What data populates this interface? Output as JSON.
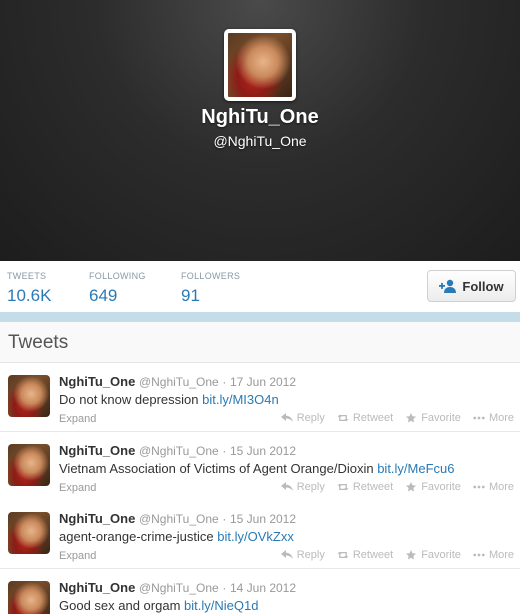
{
  "profile": {
    "name": "NghiTu_One",
    "handle": "@NghiTu_One"
  },
  "stats": {
    "tweets": {
      "label": "TWEETS",
      "value": "10.6K"
    },
    "following": {
      "label": "FOLLOWING",
      "value": "649"
    },
    "followers": {
      "label": "FOLLOWERS",
      "value": "91"
    }
  },
  "follow_button": {
    "label": "Follow"
  },
  "tweets_section": {
    "title": "Tweets"
  },
  "actions": {
    "reply": "Reply",
    "retweet": "Retweet",
    "favorite": "Favorite",
    "more": "More",
    "expand": "Expand"
  },
  "tweets": [
    {
      "author": "NghiTu_One",
      "handle": "@NghiTu_One",
      "date": "17 Jun 2012",
      "text": "Do not know depression",
      "link": "bit.ly/MI3O4n"
    },
    {
      "author": "NghiTu_One",
      "handle": "@NghiTu_One",
      "date": "15 Jun 2012",
      "text": "Vietnam Association of Victims of Agent Orange/Dioxin",
      "link": "bit.ly/MeFcu6"
    },
    {
      "author": "NghiTu_One",
      "handle": "@NghiTu_One",
      "date": "15 Jun 2012",
      "text": "agent-orange-crime-justice",
      "link": "bit.ly/OVkZxx"
    },
    {
      "author": "NghiTu_One",
      "handle": "@NghiTu_One",
      "date": "14 Jun 2012",
      "text": "Good sex and orgam",
      "link": "bit.ly/NieQ1d"
    }
  ],
  "colors": {
    "link": "#2a7ab5",
    "header_bg": "#2c2c2c",
    "divider": "#c5dce9"
  }
}
